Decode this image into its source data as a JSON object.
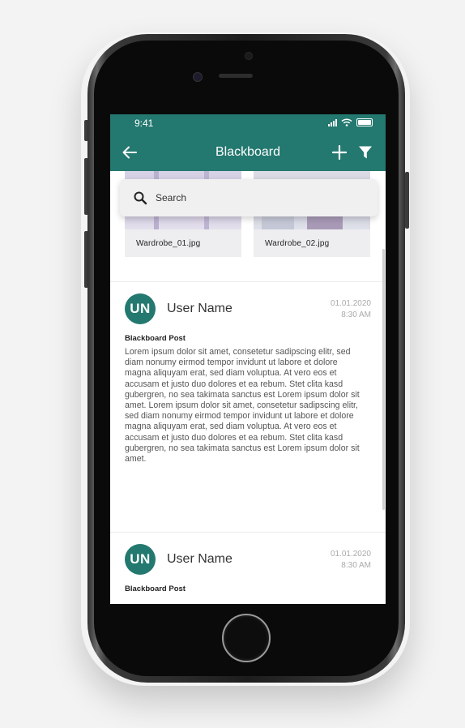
{
  "status_bar": {
    "time": "9:41"
  },
  "app_bar": {
    "title": "Blackboard"
  },
  "search": {
    "placeholder": "Search"
  },
  "attachments": [
    {
      "name": "Wardrobe_01.jpg"
    },
    {
      "name": "Wardrobe_02.jpg"
    }
  ],
  "posts": [
    {
      "avatar_initials": "UN",
      "user_name": "User Name",
      "date": "01.01.2020",
      "time": "8:30 AM",
      "title": "Blackboard Post",
      "body": "Lorem ipsum dolor sit amet, consetetur sadipscing elitr, sed diam nonumy eirmod tempor invidunt ut labore et dolore magna aliquyam erat, sed diam voluptua. At vero eos et accusam et justo duo dolores et ea rebum. Stet clita kasd gubergren, no sea takimata sanctus est Lorem ipsum dolor sit amet. Lorem ipsum dolor sit amet, consetetur sadipscing elitr, sed diam nonumy eirmod tempor invidunt ut labore et dolore magna aliquyam erat, sed diam voluptua. At vero eos et accusam et justo duo dolores et ea rebum. Stet clita kasd gubergren, no sea takimata sanctus est Lorem ipsum dolor sit amet."
    },
    {
      "avatar_initials": "UN",
      "user_name": "User Name",
      "date": "01.01.2020",
      "time": "8:30 AM",
      "title": "Blackboard Post"
    }
  ],
  "colors": {
    "brand": "#23786f",
    "background": "#f3f3f3"
  },
  "icons": [
    "back-arrow-icon",
    "add-icon",
    "filter-icon",
    "search-icon",
    "signal-icon",
    "wifi-icon",
    "battery-icon"
  ]
}
